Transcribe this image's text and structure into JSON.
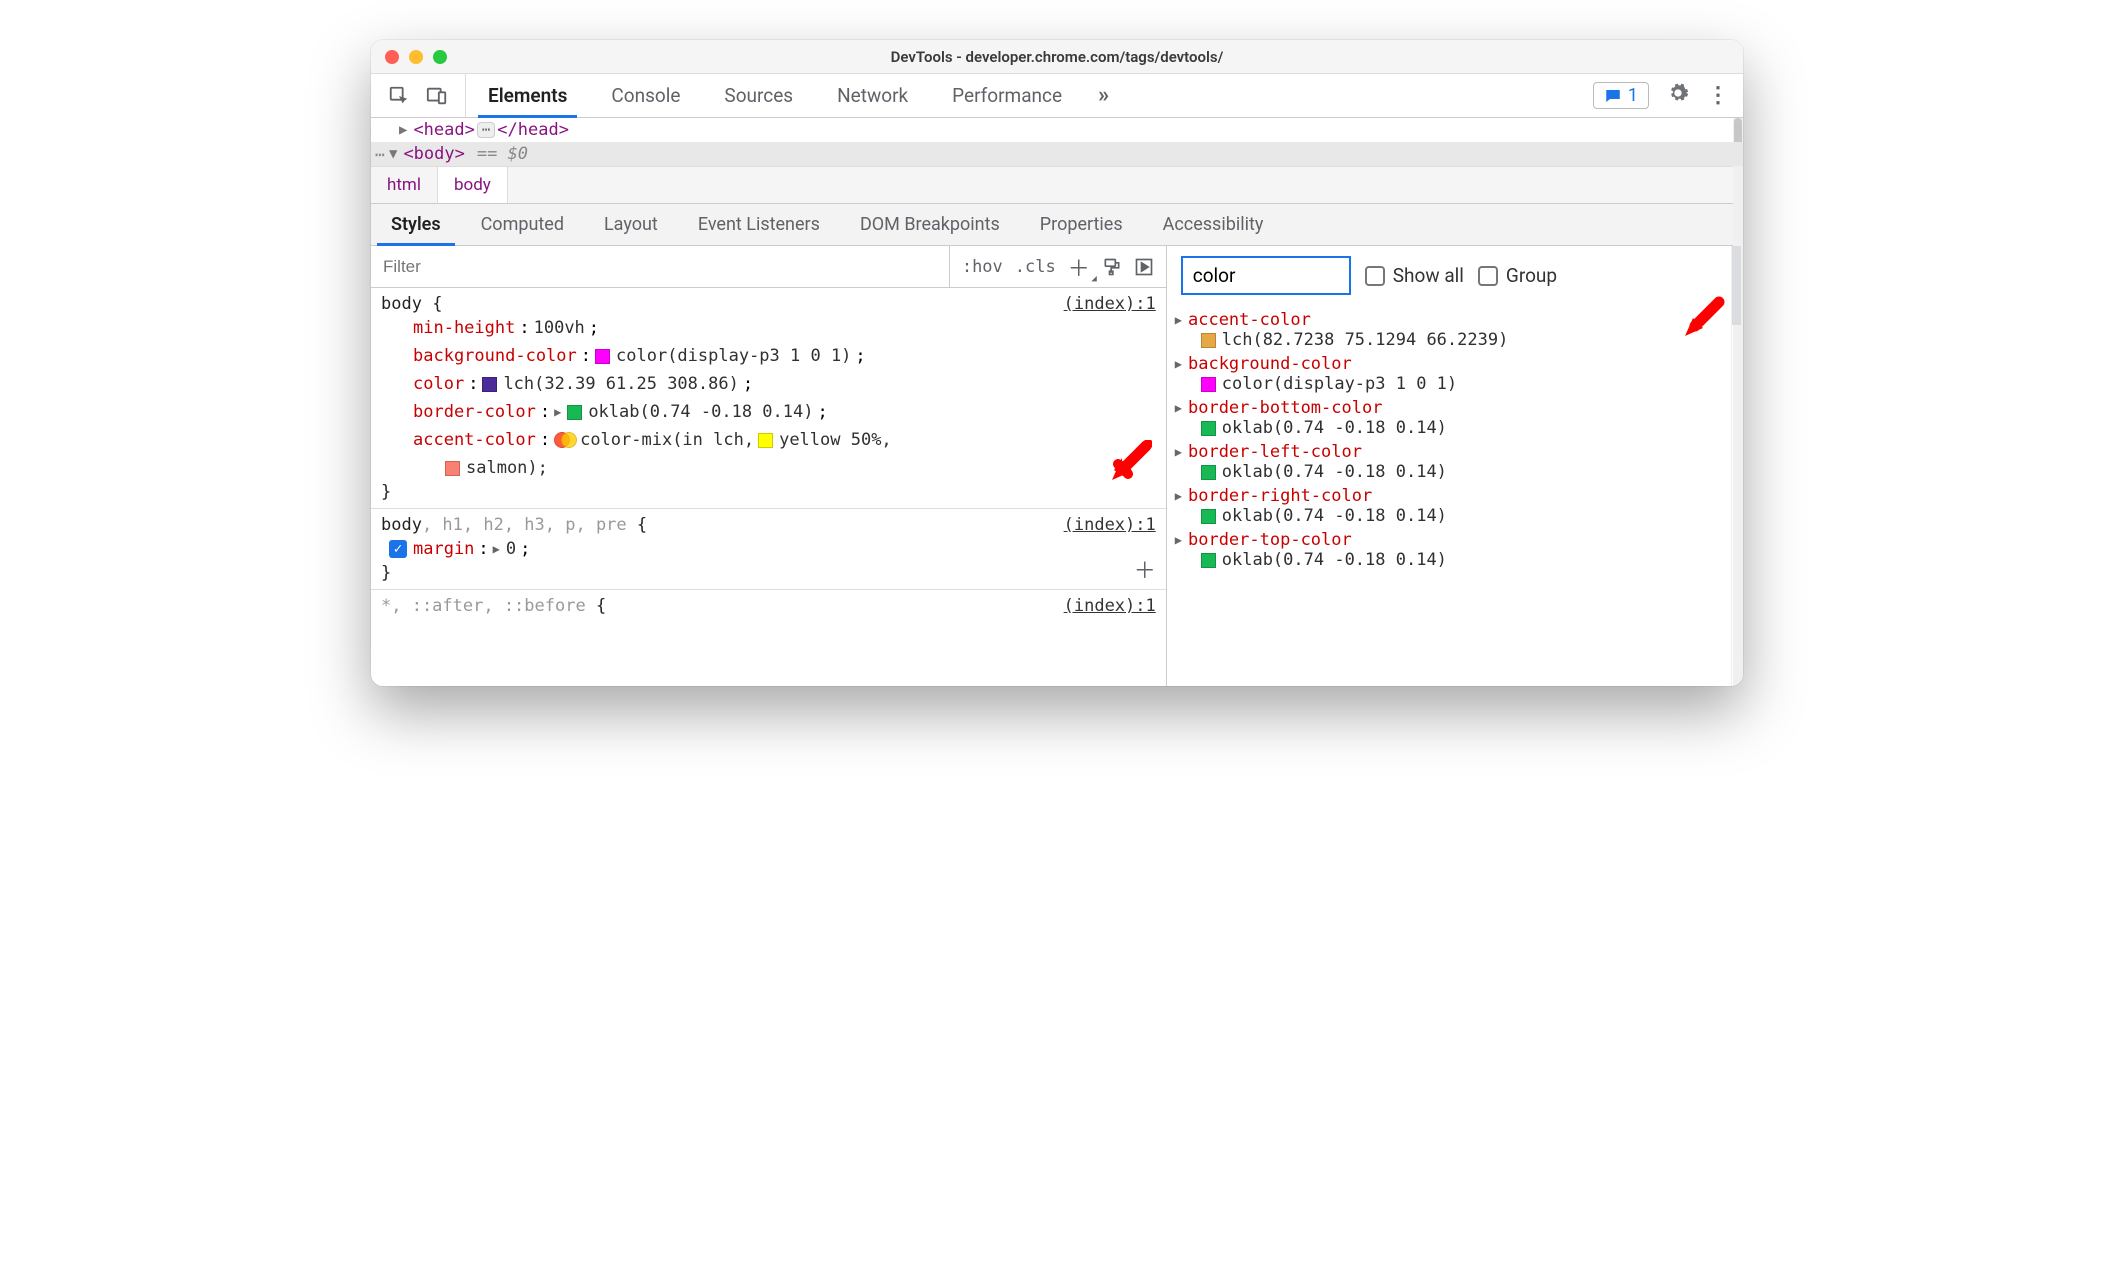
{
  "window": {
    "title": "DevTools - developer.chrome.com/tags/devtools/"
  },
  "mainTabs": [
    "Elements",
    "Console",
    "Sources",
    "Network",
    "Performance"
  ],
  "mainTabsMore": "»",
  "issuesBadge": "1",
  "dom": {
    "head_open": "<head>",
    "head_close": "</head>",
    "body_open": "<body>",
    "eq": "== $0"
  },
  "breadcrumbs": [
    "html",
    "body"
  ],
  "subTabs": [
    "Styles",
    "Computed",
    "Layout",
    "Event Listeners",
    "DOM Breakpoints",
    "Properties",
    "Accessibility"
  ],
  "stylesFilter": {
    "placeholder": "Filter",
    "hov": ":hov",
    "cls": ".cls"
  },
  "rules": [
    {
      "selector": "body",
      "source": "(index):1",
      "props": [
        {
          "name": "min-height",
          "value": "100vh"
        },
        {
          "name": "background-color",
          "value": "color(display-p3 1 0 1)",
          "swatch": "#ff00ff"
        },
        {
          "name": "color",
          "value": "lch(32.39 61.25 308.86)",
          "swatch": "#4b2a9a"
        },
        {
          "name": "border-color",
          "value": "oklab(0.74 -0.18 0.14)",
          "swatch": "#18b954",
          "expand": true
        },
        {
          "name": "accent-color",
          "value_pre": "color-mix(in lch, ",
          "mix": true,
          "mix1": "#ff5a3c",
          "mix2": "#ffcc00",
          "swatch2": "#ffff00",
          "value_mid": "yellow 50%,",
          "swatch3": "#fa8072",
          "value_end": "salmon);"
        }
      ]
    },
    {
      "selector_main": "body",
      "selector_gray": ", h1, h2, h3, p, pre",
      "source": "(index):1",
      "props": [
        {
          "name": "margin",
          "value": "0",
          "expand": true,
          "checked": true
        }
      ]
    },
    {
      "selector_gray_full": "*, ::after, ::before",
      "source": "(index):1"
    }
  ],
  "computed": {
    "filter": "color",
    "showAll": "Show all",
    "group": "Group",
    "items": [
      {
        "name": "accent-color",
        "swatch": "#e6a844",
        "value": "lch(82.7238 75.1294 66.2239)"
      },
      {
        "name": "background-color",
        "swatch": "#ff00ff",
        "value": "color(display-p3 1 0 1)"
      },
      {
        "name": "border-bottom-color",
        "swatch": "#18b954",
        "value": "oklab(0.74 -0.18 0.14)"
      },
      {
        "name": "border-left-color",
        "swatch": "#18b954",
        "value": "oklab(0.74 -0.18 0.14)"
      },
      {
        "name": "border-right-color",
        "swatch": "#18b954",
        "value": "oklab(0.74 -0.18 0.14)"
      },
      {
        "name": "border-top-color",
        "swatch": "#18b954",
        "value": "oklab(0.74 -0.18 0.14)"
      }
    ]
  }
}
